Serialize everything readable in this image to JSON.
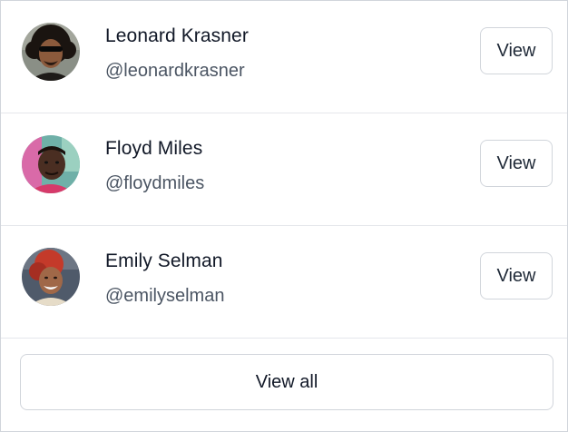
{
  "people": [
    {
      "name": "Leonard Krasner",
      "handle": "@leonardkrasner",
      "view_label": "View",
      "avatar_icon": "avatar-photo-icon"
    },
    {
      "name": "Floyd Miles",
      "handle": "@floydmiles",
      "view_label": "View",
      "avatar_icon": "avatar-photo-icon"
    },
    {
      "name": "Emily Selman",
      "handle": "@emilyselman",
      "view_label": "View",
      "avatar_icon": "avatar-photo-icon"
    }
  ],
  "view_all_label": "View all",
  "colors": {
    "border": "#d1d5db",
    "divider": "#e5e7eb",
    "name_text": "#111827",
    "handle_text": "#4b5563"
  }
}
